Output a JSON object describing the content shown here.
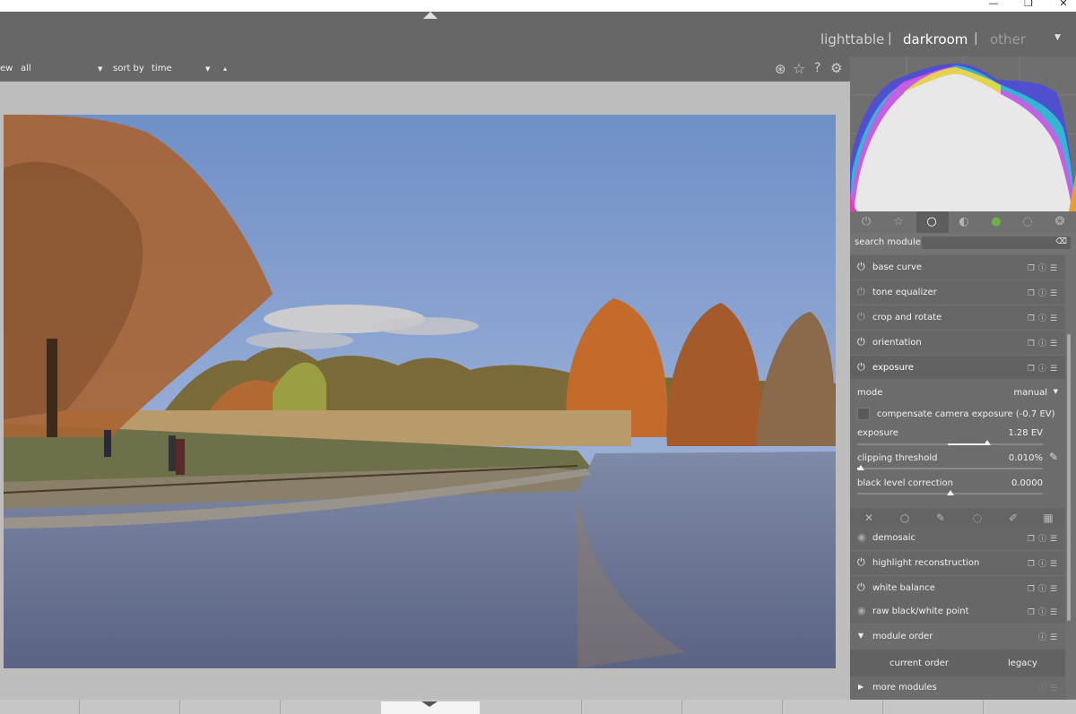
{
  "window": {
    "minimize": "—",
    "maximize": "❐",
    "close": "✕"
  },
  "views": {
    "lighttable": "lighttable",
    "sep1": "|",
    "darkroom": "darkroom",
    "sep2": "|",
    "other": "other"
  },
  "filterbar": {
    "view_label": "ew",
    "view_value": "all",
    "sort_label": "sort by",
    "sort_value": "time",
    "sort_dir": "▴"
  },
  "top_icons": [
    "display-icon",
    "star-icon",
    "help-icon",
    "gear-icon"
  ],
  "module_groups": [
    "power-icon",
    "star-icon",
    "circle-icon",
    "halftone-icon",
    "color-icon",
    "shape-icon",
    "effects-icon"
  ],
  "search": {
    "label": "search module",
    "value": ""
  },
  "modules_top": [
    {
      "name": "base curve",
      "on": true
    },
    {
      "name": "tone equalizer",
      "on": false
    },
    {
      "name": "crop and rotate",
      "on": false
    },
    {
      "name": "orientation",
      "on": true
    },
    {
      "name": "exposure",
      "on": true
    }
  ],
  "exposure": {
    "mode_label": "mode",
    "mode_value": "manual",
    "compensate_label": "compensate camera exposure (-0.7 EV)",
    "compensate_checked": false,
    "exposure_label": "exposure",
    "exposure_value": "1.28 EV",
    "exposure_level": 0.7,
    "clipping_label": "clipping threshold",
    "clipping_value": "0.010%",
    "clipping_level": 0.02,
    "black_label": "black level correction",
    "black_value": "0.0000",
    "black_level": 0.5
  },
  "mask_icons": [
    "off-icon",
    "uniform-icon",
    "drawn-icon",
    "parametric-icon",
    "drawn-parametric-icon",
    "raster-icon"
  ],
  "modules_bottom": [
    {
      "name": "demosaic",
      "on": true
    },
    {
      "name": "highlight reconstruction",
      "on": true
    },
    {
      "name": "white balance",
      "on": true
    },
    {
      "name": "raw black/white point",
      "on": true
    }
  ],
  "module_order": {
    "label": "module order",
    "current": "current order",
    "preset": "legacy"
  },
  "more_modules": "more modules",
  "colors": {
    "panel": "#717171",
    "header": "#676767",
    "canvas": "#bdbdbd"
  }
}
